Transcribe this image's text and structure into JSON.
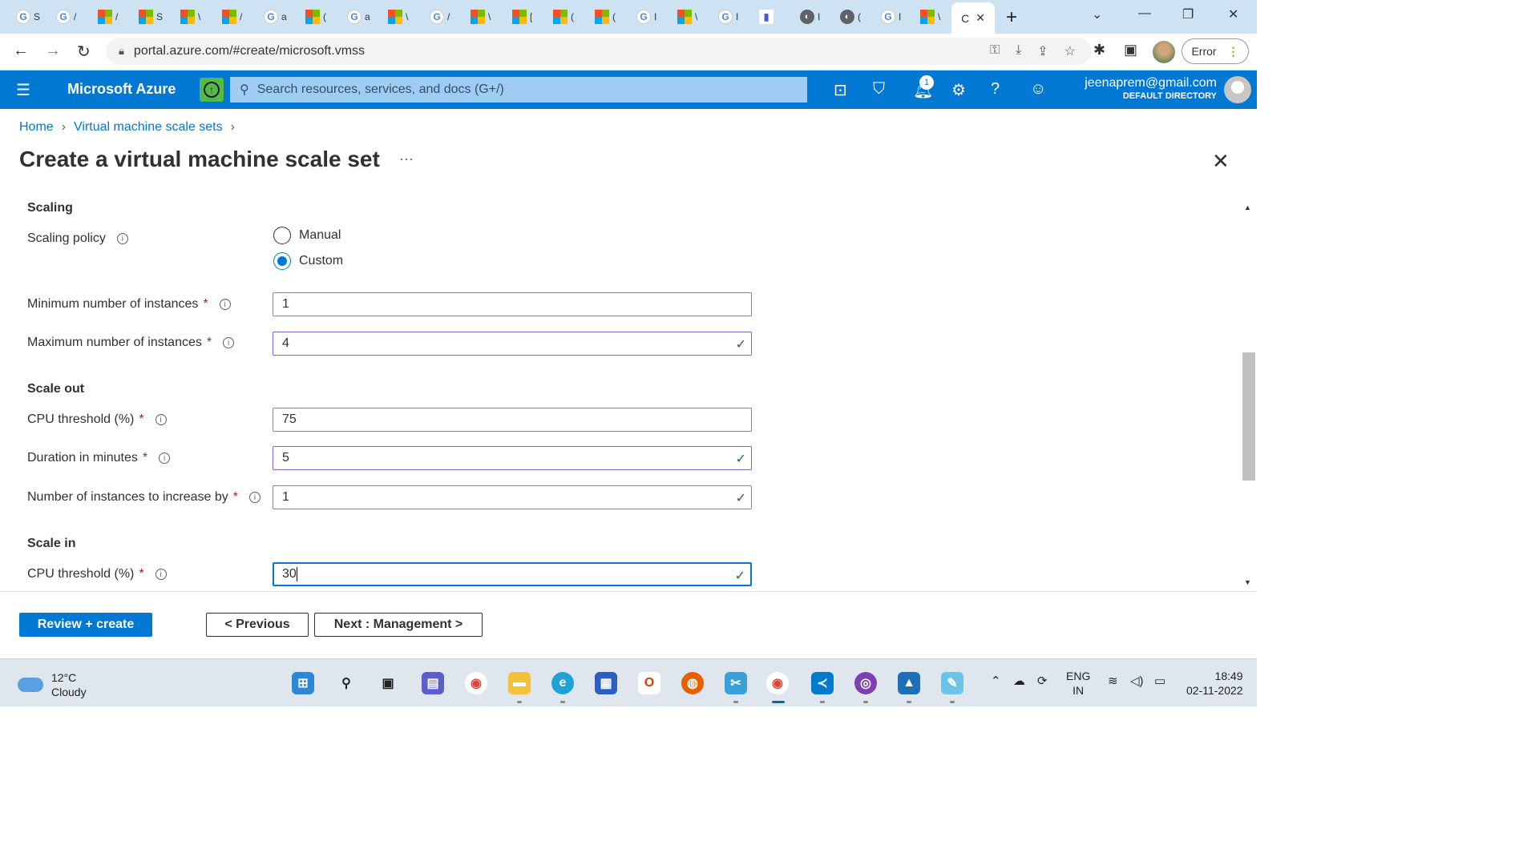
{
  "browser": {
    "tab_chars": [
      "S",
      "/",
      "/",
      "S",
      "\\",
      "/",
      "a",
      "(",
      "a",
      "\\",
      "/",
      "\\",
      "[",
      "(",
      "(",
      "I",
      "\\",
      "I",
      "",
      "I",
      "(",
      "I",
      "\\",
      "\\",
      "\\"
    ],
    "active_tab_char": "C",
    "url": "portal.azure.com/#create/microsoft.vmss",
    "profile_button": "Error"
  },
  "azure": {
    "brand": "Microsoft Azure",
    "search_placeholder": "Search resources, services, and docs (G+/)",
    "notification_count": "1",
    "account_email": "jeenaprem@gmail.com",
    "account_directory": "DEFAULT DIRECTORY"
  },
  "breadcrumb": {
    "home": "Home",
    "parent": "Virtual machine scale sets"
  },
  "page": {
    "title": "Create a virtual machine scale set",
    "more": "···"
  },
  "form": {
    "scaling_section": "Scaling",
    "scaling_policy_label": "Scaling policy",
    "radio_manual": "Manual",
    "radio_custom": "Custom",
    "selected_policy": "Custom",
    "min_instances_label": "Minimum number of instances",
    "min_instances_value": "1",
    "max_instances_label": "Maximum number of instances",
    "max_instances_value": "4",
    "scale_out_section": "Scale out",
    "out_cpu_label": "CPU threshold (%)",
    "out_cpu_value": "75",
    "duration_label": "Duration in minutes",
    "duration_value": "5",
    "increase_label": "Number of instances to increase by",
    "increase_value": "1",
    "scale_in_section": "Scale in",
    "in_cpu_label": "CPU threshold (%)",
    "in_cpu_value": "30"
  },
  "footer": {
    "review_create": "Review + create",
    "previous": "< Previous",
    "next": "Next : Management >"
  },
  "taskbar": {
    "temperature": "12°C",
    "condition": "Cloudy",
    "lang1": "ENG",
    "lang2": "IN",
    "time": "18:49",
    "date": "02-11-2022"
  },
  "colors": {
    "azure_blue": "#0078d4",
    "valid_border": "#8661c5",
    "check_green": "#107c10"
  }
}
